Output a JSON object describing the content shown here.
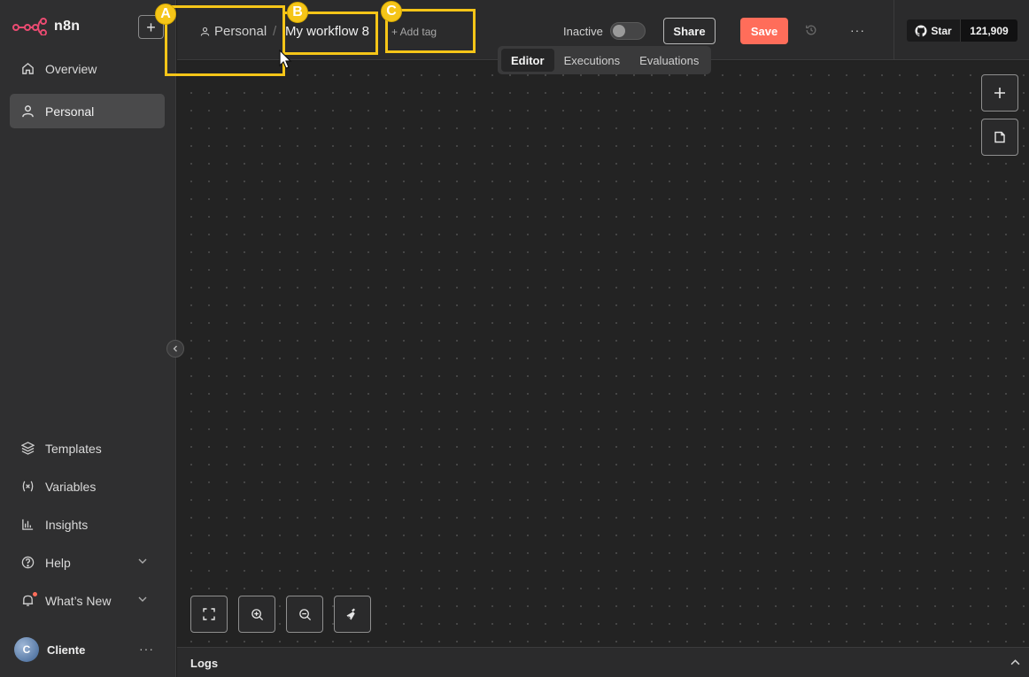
{
  "app": {
    "name": "n8n"
  },
  "sidebar": {
    "add_label": "+",
    "top_items": [
      {
        "label": "Overview",
        "icon": "home-icon"
      },
      {
        "label": "Personal",
        "icon": "user-icon",
        "active": true
      }
    ],
    "bottom_items": [
      {
        "label": "Templates",
        "icon": "box-icon"
      },
      {
        "label": "Variables",
        "icon": "variable-icon"
      },
      {
        "label": "Insights",
        "icon": "bar-chart-icon"
      },
      {
        "label": "Help",
        "icon": "help-circle-icon"
      },
      {
        "label": "What’s New",
        "icon": "bell-icon"
      }
    ],
    "user": {
      "initial": "C",
      "name": "Cliente",
      "more": "···"
    }
  },
  "header": {
    "breadcrumb": {
      "project": "Personal",
      "separator": "/",
      "workflow": "My workflow 8"
    },
    "add_tag": "+ Add tag",
    "status": "Inactive",
    "share_label": "Share",
    "save_label": "Save",
    "more": "···",
    "github": {
      "star_label": "Star",
      "count": "121,909"
    }
  },
  "tabs": [
    {
      "label": "Editor",
      "active": true
    },
    {
      "label": "Executions"
    },
    {
      "label": "Evaluations"
    }
  ],
  "logs": {
    "label": "Logs"
  },
  "annotations": [
    {
      "label": "A"
    },
    {
      "label": "B"
    },
    {
      "label": "C"
    }
  ],
  "colors": {
    "accent": "#ff6d5a",
    "annotation": "#f5c518",
    "sidebar_bg": "#2f2f30",
    "canvas_bg": "#232323"
  }
}
